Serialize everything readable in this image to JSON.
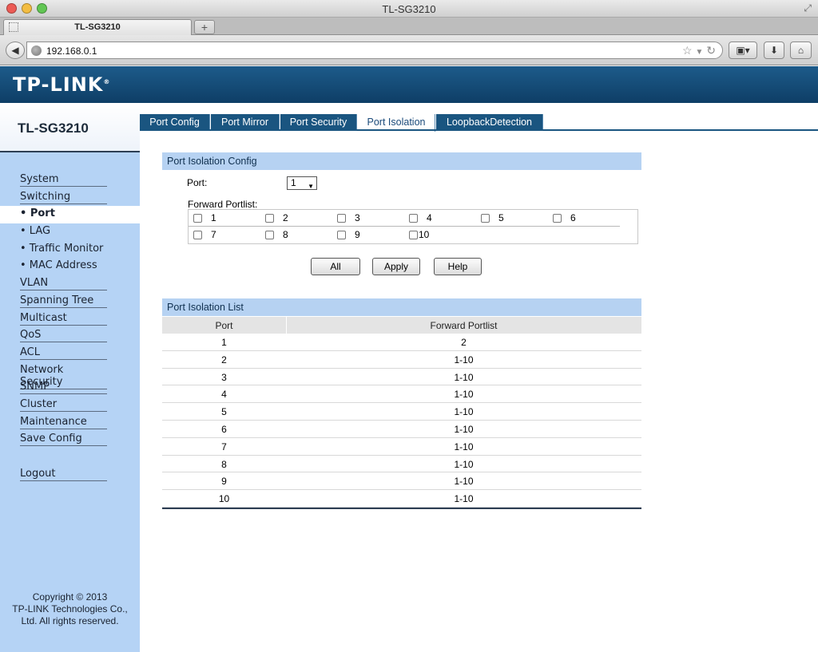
{
  "window": {
    "title": "TL-SG3210"
  },
  "browser": {
    "tab_label": "TL-SG3210",
    "new_tab": "+",
    "url": "192.168.0.1"
  },
  "header": {
    "logo": "TP-LINK"
  },
  "sidebar": {
    "model": "TL-SG3210",
    "items": [
      {
        "label": "System"
      },
      {
        "label": "Switching"
      },
      {
        "label": "• Port"
      },
      {
        "label": "• LAG"
      },
      {
        "label": "• Traffic Monitor"
      },
      {
        "label": "• MAC Address"
      },
      {
        "label": "VLAN"
      },
      {
        "label": "Spanning Tree"
      },
      {
        "label": "Multicast"
      },
      {
        "label": "QoS"
      },
      {
        "label": "ACL"
      },
      {
        "label": "Network Security"
      },
      {
        "label": "SNMP"
      },
      {
        "label": "Cluster"
      },
      {
        "label": "Maintenance"
      },
      {
        "label": "Save Config"
      },
      {
        "label": "Logout"
      }
    ],
    "copyright": [
      "Copyright © 2013",
      "TP-LINK Technologies Co.,",
      "Ltd. All rights reserved."
    ]
  },
  "tabs": [
    {
      "label": "Port Config"
    },
    {
      "label": "Port Mirror"
    },
    {
      "label": "Port Security"
    },
    {
      "label": "Port Isolation",
      "active": true
    },
    {
      "label": "LoopbackDetection"
    }
  ],
  "config": {
    "title": "Port Isolation Config",
    "port_label": "Port:",
    "port_value": "1",
    "portlist_label": "Forward Portlist:",
    "ports": [
      "1",
      "2",
      "3",
      "4",
      "5",
      "6",
      "7",
      "8",
      "9",
      "10"
    ],
    "buttons": {
      "all": "All",
      "apply": "Apply",
      "help": "Help"
    }
  },
  "list": {
    "title": "Port Isolation List",
    "columns": [
      "Port",
      "Forward Portlist"
    ],
    "rows": [
      [
        "1",
        "2"
      ],
      [
        "2",
        "1-10"
      ],
      [
        "3",
        "1-10"
      ],
      [
        "4",
        "1-10"
      ],
      [
        "5",
        "1-10"
      ],
      [
        "6",
        "1-10"
      ],
      [
        "7",
        "1-10"
      ],
      [
        "8",
        "1-10"
      ],
      [
        "9",
        "1-10"
      ],
      [
        "10",
        "1-10"
      ]
    ]
  }
}
